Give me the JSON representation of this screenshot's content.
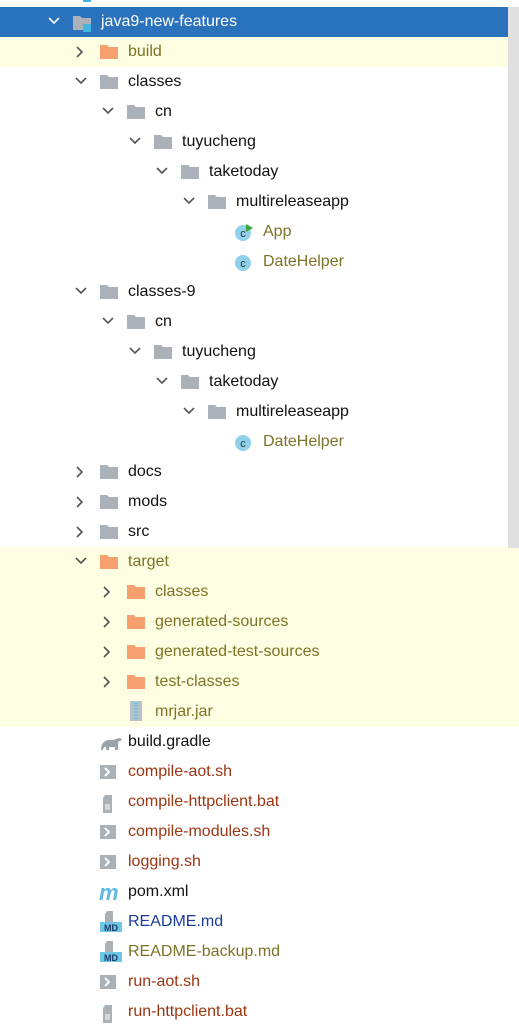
{
  "colors": {
    "selection": "#2a72bc",
    "ignored_bg": "#fefee2",
    "folder_gray": "#aab1b8",
    "folder_orange": "#f6a06f",
    "class_icon": "#8fd0eb",
    "olive_text": "#7b7325",
    "red_text": "#9c3512",
    "blue_text": "#1a3b9f"
  },
  "tree": [
    {
      "label": "",
      "level": 0,
      "icon": "module-folder-icon",
      "chevron": "none",
      "color": "default"
    },
    {
      "label": "java9-new-features",
      "level": 0,
      "icon": "module-folder-icon",
      "chevron": "expanded",
      "color": "default",
      "selected": true
    },
    {
      "label": "build",
      "level": 1,
      "icon": "folder-orange-icon",
      "chevron": "collapsed",
      "color": "olive",
      "ignored": true
    },
    {
      "label": "classes",
      "level": 1,
      "icon": "folder-icon",
      "chevron": "expanded",
      "color": "default"
    },
    {
      "label": "cn",
      "level": 2,
      "icon": "folder-icon",
      "chevron": "expanded",
      "color": "default"
    },
    {
      "label": "tuyucheng",
      "level": 3,
      "icon": "folder-icon",
      "chevron": "expanded",
      "color": "default"
    },
    {
      "label": "taketoday",
      "level": 4,
      "icon": "folder-icon",
      "chevron": "expanded",
      "color": "default"
    },
    {
      "label": "multireleaseapp",
      "level": 5,
      "icon": "folder-icon",
      "chevron": "expanded",
      "color": "default"
    },
    {
      "label": "App",
      "level": 6,
      "icon": "class-runnable-icon",
      "chevron": "none",
      "color": "olive"
    },
    {
      "label": "DateHelper",
      "level": 6,
      "icon": "class-icon",
      "chevron": "none",
      "color": "olive"
    },
    {
      "label": "classes-9",
      "level": 1,
      "icon": "folder-icon",
      "chevron": "expanded",
      "color": "default"
    },
    {
      "label": "cn",
      "level": 2,
      "icon": "folder-icon",
      "chevron": "expanded",
      "color": "default"
    },
    {
      "label": "tuyucheng",
      "level": 3,
      "icon": "folder-icon",
      "chevron": "expanded",
      "color": "default"
    },
    {
      "label": "taketoday",
      "level": 4,
      "icon": "folder-icon",
      "chevron": "expanded",
      "color": "default"
    },
    {
      "label": "multireleaseapp",
      "level": 5,
      "icon": "folder-icon",
      "chevron": "expanded",
      "color": "default"
    },
    {
      "label": "DateHelper",
      "level": 6,
      "icon": "class-icon",
      "chevron": "none",
      "color": "olive"
    },
    {
      "label": "docs",
      "level": 1,
      "icon": "folder-icon",
      "chevron": "collapsed",
      "color": "default"
    },
    {
      "label": "mods",
      "level": 1,
      "icon": "folder-icon",
      "chevron": "collapsed",
      "color": "default"
    },
    {
      "label": "src",
      "level": 1,
      "icon": "folder-icon",
      "chevron": "collapsed",
      "color": "default"
    },
    {
      "label": "target",
      "level": 1,
      "icon": "folder-orange-icon",
      "chevron": "expanded",
      "color": "olive",
      "ignored": true
    },
    {
      "label": "classes",
      "level": 2,
      "icon": "folder-orange-icon",
      "chevron": "collapsed",
      "color": "olive",
      "ignored": true
    },
    {
      "label": "generated-sources",
      "level": 2,
      "icon": "folder-orange-icon",
      "chevron": "collapsed",
      "color": "olive",
      "ignored": true
    },
    {
      "label": "generated-test-sources",
      "level": 2,
      "icon": "folder-orange-icon",
      "chevron": "collapsed",
      "color": "olive",
      "ignored": true
    },
    {
      "label": "test-classes",
      "level": 2,
      "icon": "folder-orange-icon",
      "chevron": "collapsed",
      "color": "olive",
      "ignored": true
    },
    {
      "label": "mrjar.jar",
      "level": 2,
      "icon": "jar-icon",
      "chevron": "none",
      "color": "olive",
      "ignored": true
    },
    {
      "label": "build.gradle",
      "level": 1,
      "icon": "gradle-icon",
      "chevron": "none",
      "color": "default"
    },
    {
      "label": "compile-aot.sh",
      "level": 1,
      "icon": "shell-script-icon",
      "chevron": "none",
      "color": "red"
    },
    {
      "label": "compile-httpclient.bat",
      "level": 1,
      "icon": "text-file-icon",
      "chevron": "none",
      "color": "red"
    },
    {
      "label": "compile-modules.sh",
      "level": 1,
      "icon": "shell-script-icon",
      "chevron": "none",
      "color": "red"
    },
    {
      "label": "logging.sh",
      "level": 1,
      "icon": "shell-script-icon",
      "chevron": "none",
      "color": "red"
    },
    {
      "label": "pom.xml",
      "level": 1,
      "icon": "maven-icon",
      "chevron": "none",
      "color": "default"
    },
    {
      "label": "README.md",
      "level": 1,
      "icon": "markdown-icon",
      "chevron": "none",
      "color": "blue"
    },
    {
      "label": "README-backup.md",
      "level": 1,
      "icon": "markdown-icon",
      "chevron": "none",
      "color": "olive"
    },
    {
      "label": "run-aot.sh",
      "level": 1,
      "icon": "shell-script-icon",
      "chevron": "none",
      "color": "red"
    },
    {
      "label": "run-httpclient.bat",
      "level": 1,
      "icon": "text-file-icon",
      "chevron": "none",
      "color": "red"
    }
  ]
}
